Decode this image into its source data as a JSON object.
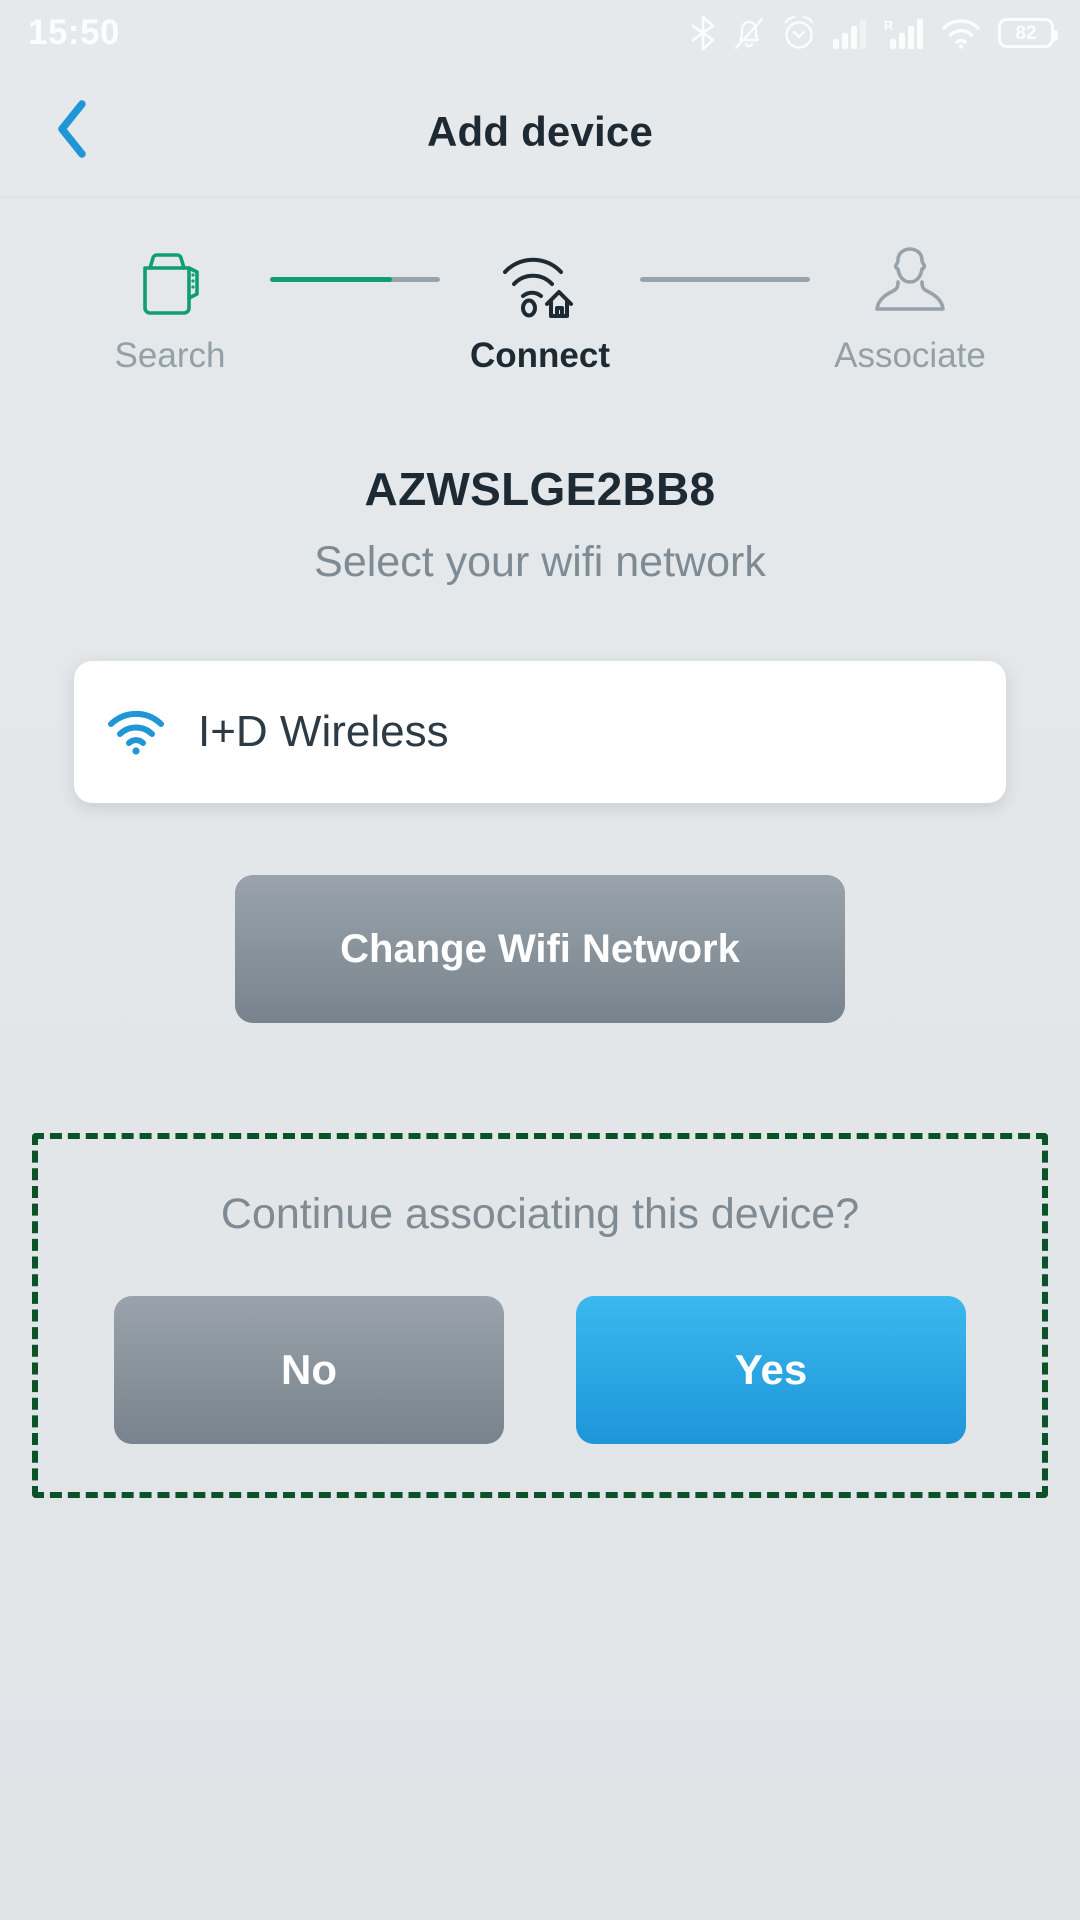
{
  "status_bar": {
    "time": "15:50",
    "battery_level": "82",
    "icons": [
      "bluetooth-icon",
      "bell-muted-icon",
      "alarm-clock-icon",
      "signal-bars-icon",
      "signal-bars-roaming-icon",
      "wifi-icon",
      "battery-icon"
    ]
  },
  "header": {
    "title": "Add device",
    "back_icon": "chevron-left-icon",
    "back_color": "#2196d6"
  },
  "stepper": {
    "active_index": 1,
    "progress_fill_percent": 72,
    "active_color": "#0e9e71",
    "inactive_color": "#98a2ac",
    "steps": [
      {
        "label": "Search",
        "icon": "device-box-icon",
        "state": "done"
      },
      {
        "label": "Connect",
        "icon": "wifi-home-icon",
        "state": "active"
      },
      {
        "label": "Associate",
        "icon": "user-person-icon",
        "state": "pending"
      }
    ]
  },
  "main": {
    "device_name": "AZWSLGE2BB8",
    "subtitle": "Select your wifi network",
    "wifi_card": {
      "ssid": "I+D Wireless",
      "icon": "wifi-icon",
      "icon_color": "#2196d6"
    },
    "change_network_button": "Change Wifi Network"
  },
  "confirm": {
    "message": "Continue associating this device?",
    "border_color": "#0b5228",
    "no_label": "No",
    "yes_label": "Yes",
    "yes_color": "#2aa9e6",
    "no_color": "#8b959e"
  }
}
